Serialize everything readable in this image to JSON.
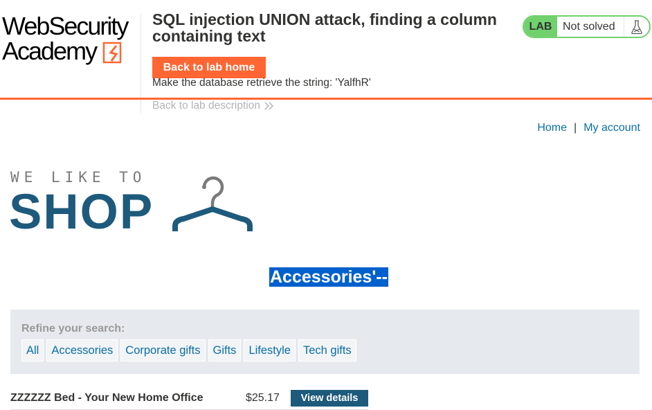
{
  "academy": {
    "logo_line1": "WebSecurity",
    "logo_line2": "Academy",
    "lab_title": "SQL injection UNION attack, finding a column containing text",
    "back_to_lab_home": "Back to lab home",
    "objective": "Make the database retrieve the string: 'YalfhR'",
    "back_to_description": "Back to lab description",
    "status": {
      "tag": "LAB",
      "text": "Not solved",
      "color": "#70d16d"
    },
    "accent_color": "#ff6633"
  },
  "nav": {
    "home": "Home",
    "separator": "|",
    "my_account": "My account"
  },
  "shop_logo": {
    "tagline": "WE LIKE TO",
    "word": "SHOP",
    "icon": "hanger-icon"
  },
  "category_heading": "Accessories'--",
  "filter": {
    "label": "Refine your search:",
    "categories": [
      "All",
      "Accessories",
      "Corporate gifts",
      "Gifts",
      "Lifestyle",
      "Tech gifts"
    ]
  },
  "products": [
    {
      "name": "ZZZZZZ Bed - Your New Home Office",
      "price": "$25.17",
      "action": "View details"
    }
  ]
}
